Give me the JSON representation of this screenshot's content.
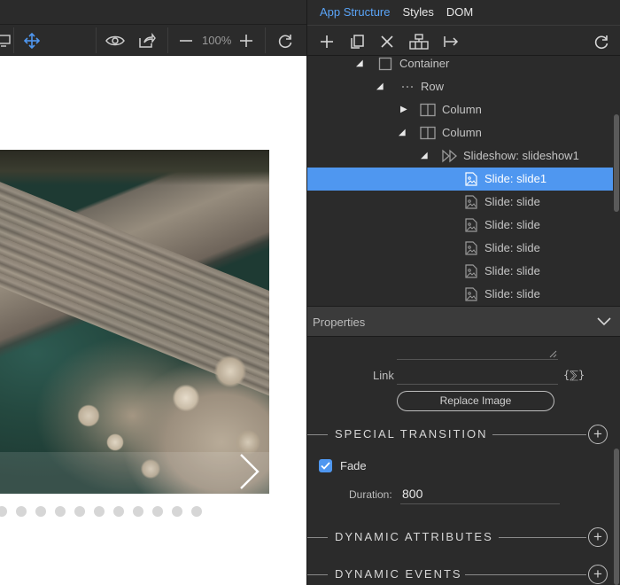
{
  "app_tabs": [
    {
      "label": "App Structure",
      "active": true
    },
    {
      "label": "Styles",
      "active": false
    },
    {
      "label": "DOM",
      "active": false
    }
  ],
  "canvas_toolbar": {
    "zoom": "100%",
    "icons": [
      "desktop-icon",
      "move-icon",
      "preview-eye-icon",
      "share-icon",
      "zoom-out-icon",
      "zoom-in-icon",
      "refresh-icon"
    ]
  },
  "structure_toolbar": {
    "icons": [
      "add-icon",
      "duplicate-icon",
      "delete-icon",
      "wrap-icon",
      "move-out-icon",
      "refresh-icon"
    ]
  },
  "tree": [
    {
      "label": "Container",
      "depth": 0,
      "icon": "container-icon",
      "expanded": true,
      "selected": false
    },
    {
      "label": "Row",
      "depth": 1,
      "icon": "row-icon",
      "expanded": true,
      "selected": false
    },
    {
      "label": "Column",
      "depth": 2,
      "icon": "column-icon",
      "expanded": false,
      "selected": false
    },
    {
      "label": "Column",
      "depth": 2,
      "icon": "column-icon",
      "expanded": true,
      "selected": false
    },
    {
      "label": "Slideshow: slideshow1",
      "depth": 3,
      "icon": "slideshow-icon",
      "expanded": true,
      "selected": false
    },
    {
      "label": "Slide: slide1",
      "depth": 4,
      "icon": "slide-image-icon",
      "selected": true
    },
    {
      "label": "Slide: slide",
      "depth": 4,
      "icon": "slide-image-icon",
      "selected": false
    },
    {
      "label": "Slide: slide",
      "depth": 4,
      "icon": "slide-image-icon",
      "selected": false
    },
    {
      "label": "Slide: slide",
      "depth": 4,
      "icon": "slide-image-icon",
      "selected": false
    },
    {
      "label": "Slide: slide",
      "depth": 4,
      "icon": "slide-image-icon",
      "selected": false
    },
    {
      "label": "Slide: slide",
      "depth": 4,
      "icon": "slide-image-icon",
      "selected": false
    }
  ],
  "properties": {
    "title": "Properties",
    "link_label": "Link",
    "link_value": "",
    "dynamic_button": "{⅀}",
    "replace_image_label": "Replace Image",
    "special_transition_title": "SPECIAL TRANSITION",
    "fade_label": "Fade",
    "fade_checked": true,
    "duration_label": "Duration:",
    "duration_value": "800",
    "dynamic_attributes_title": "DYNAMIC ATTRIBUTES",
    "dynamic_events_title": "DYNAMIC EVENTS"
  },
  "slideshow_preview": {
    "dot_count": 11,
    "next_arrow": "›"
  },
  "colors": {
    "accent": "#4f97f0",
    "tab_active": "#5aa4f7",
    "panel_bg": "#2b2b2b"
  }
}
